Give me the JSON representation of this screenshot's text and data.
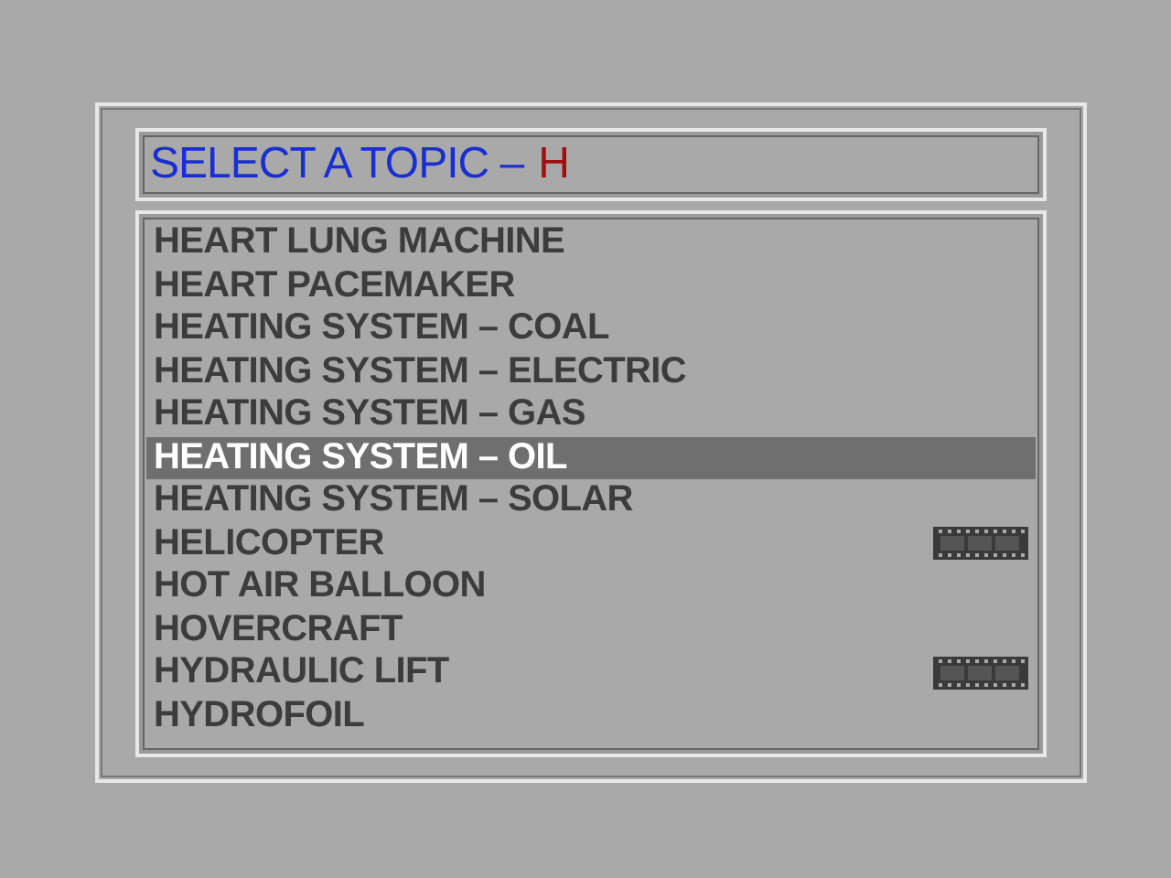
{
  "header": {
    "prompt": "SELECT A TOPIC –",
    "letter": "H"
  },
  "topics": [
    {
      "label": "HEART LUNG MACHINE",
      "selected": false,
      "film": false
    },
    {
      "label": "HEART PACEMAKER",
      "selected": false,
      "film": false
    },
    {
      "label": "HEATING SYSTEM – COAL",
      "selected": false,
      "film": false
    },
    {
      "label": "HEATING SYSTEM – ELECTRIC",
      "selected": false,
      "film": false
    },
    {
      "label": "HEATING SYSTEM – GAS",
      "selected": false,
      "film": false
    },
    {
      "label": "HEATING SYSTEM – OIL",
      "selected": true,
      "film": false
    },
    {
      "label": "HEATING SYSTEM – SOLAR",
      "selected": false,
      "film": false
    },
    {
      "label": "HELICOPTER",
      "selected": false,
      "film": true
    },
    {
      "label": "HOT AIR BALLOON",
      "selected": false,
      "film": false
    },
    {
      "label": "HOVERCRAFT",
      "selected": false,
      "film": false
    },
    {
      "label": "HYDRAULIC LIFT",
      "selected": false,
      "film": true
    },
    {
      "label": "HYDROFOIL",
      "selected": false,
      "film": false
    }
  ]
}
